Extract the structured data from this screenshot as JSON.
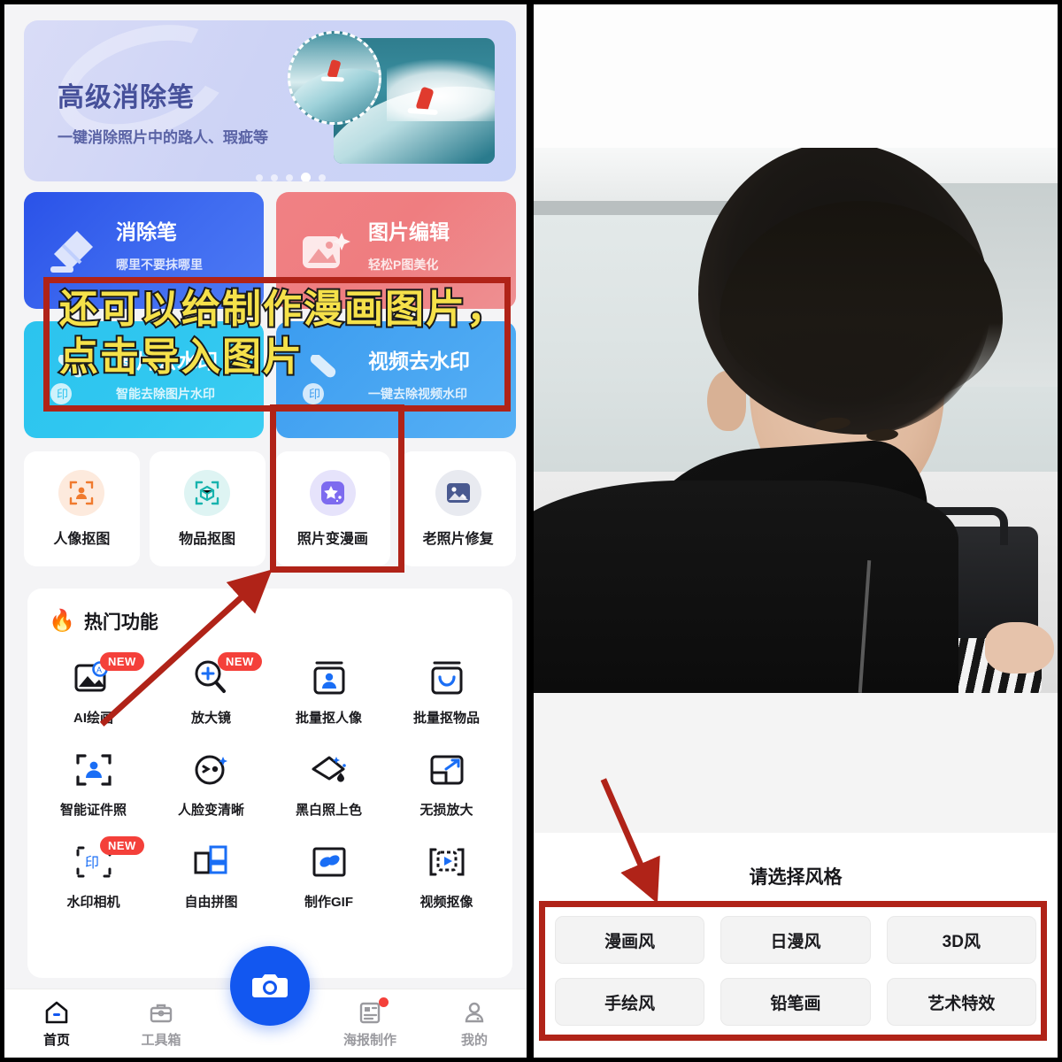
{
  "left": {
    "banner": {
      "title": "高级消除笔",
      "subtitle": "一键消除照片中的路人、瑕疵等",
      "dots_total": 5,
      "dots_active_index": 3
    },
    "cards": [
      {
        "title": "消除笔",
        "subtitle": "哪里不要抹哪里",
        "icon": "eraser-pen-icon",
        "color": "#2a52e8"
      },
      {
        "title": "图片编辑",
        "subtitle": "轻松P图美化",
        "icon": "image-edit-icon",
        "color": "#f08184"
      },
      {
        "title": "图片去水印",
        "subtitle": "智能去除图片水印",
        "icon": "image-watermark-icon",
        "color": "#2cc3ee"
      },
      {
        "title": "视频去水印",
        "subtitle": "一键去除视频水印",
        "icon": "video-watermark-icon",
        "color": "#3b9cf0"
      }
    ],
    "tiles": [
      {
        "label": "人像抠图",
        "icon": "portrait-cutout-icon"
      },
      {
        "label": "物品抠图",
        "icon": "object-cutout-icon"
      },
      {
        "label": "照片变漫画",
        "icon": "photo-to-comic-icon"
      },
      {
        "label": "老照片修复",
        "icon": "old-photo-repair-icon"
      }
    ],
    "hot": {
      "title": "热门功能",
      "flame_icon": "flame-icon",
      "badge_new": "NEW",
      "items": [
        {
          "label": "AI绘画",
          "icon": "ai-paint-icon",
          "badge": "NEW"
        },
        {
          "label": "放大镜",
          "icon": "magnifier-plus-icon",
          "badge": "NEW"
        },
        {
          "label": "批量抠人像",
          "icon": "batch-portrait-icon",
          "badge": ""
        },
        {
          "label": "批量抠物品",
          "icon": "batch-object-icon",
          "badge": ""
        },
        {
          "label": "智能证件照",
          "icon": "id-photo-icon",
          "badge": ""
        },
        {
          "label": "人脸变清晰",
          "icon": "face-enhance-icon",
          "badge": ""
        },
        {
          "label": "黑白照上色",
          "icon": "colorize-icon",
          "badge": ""
        },
        {
          "label": "无损放大",
          "icon": "lossless-upscale-icon",
          "badge": ""
        },
        {
          "label": "水印相机",
          "icon": "watermark-camera-icon",
          "badge": "NEW"
        },
        {
          "label": "自由拼图",
          "icon": "free-collage-icon",
          "badge": ""
        },
        {
          "label": "制作GIF",
          "icon": "make-gif-icon",
          "badge": ""
        },
        {
          "label": "视频抠像",
          "icon": "video-matting-icon",
          "badge": ""
        }
      ]
    },
    "nav": [
      {
        "label": "首页",
        "icon": "home-icon",
        "active": true,
        "dot": false
      },
      {
        "label": "工具箱",
        "icon": "toolbox-icon",
        "active": false,
        "dot": false
      },
      {
        "label": "",
        "icon": "camera-fab-icon",
        "active": false,
        "dot": false
      },
      {
        "label": "海报制作",
        "icon": "poster-icon",
        "active": false,
        "dot": true
      },
      {
        "label": "我的",
        "icon": "profile-icon",
        "active": false,
        "dot": false
      }
    ],
    "camera_fab_icon": "camera-icon",
    "annotation": {
      "text": "还可以给制作漫画图片，\n点击导入图片",
      "text_color": "#f5e14a",
      "outline_color": "#1a1a1a",
      "box_color": "#b02318"
    }
  },
  "right": {
    "style_prompt": "请选择风格",
    "styles": [
      "漫画风",
      "日漫风",
      "3D风",
      "手绘风",
      "铅笔画",
      "艺术特效"
    ],
    "annotation": {
      "box_color": "#b02318",
      "arrow_color": "#b02318"
    }
  }
}
